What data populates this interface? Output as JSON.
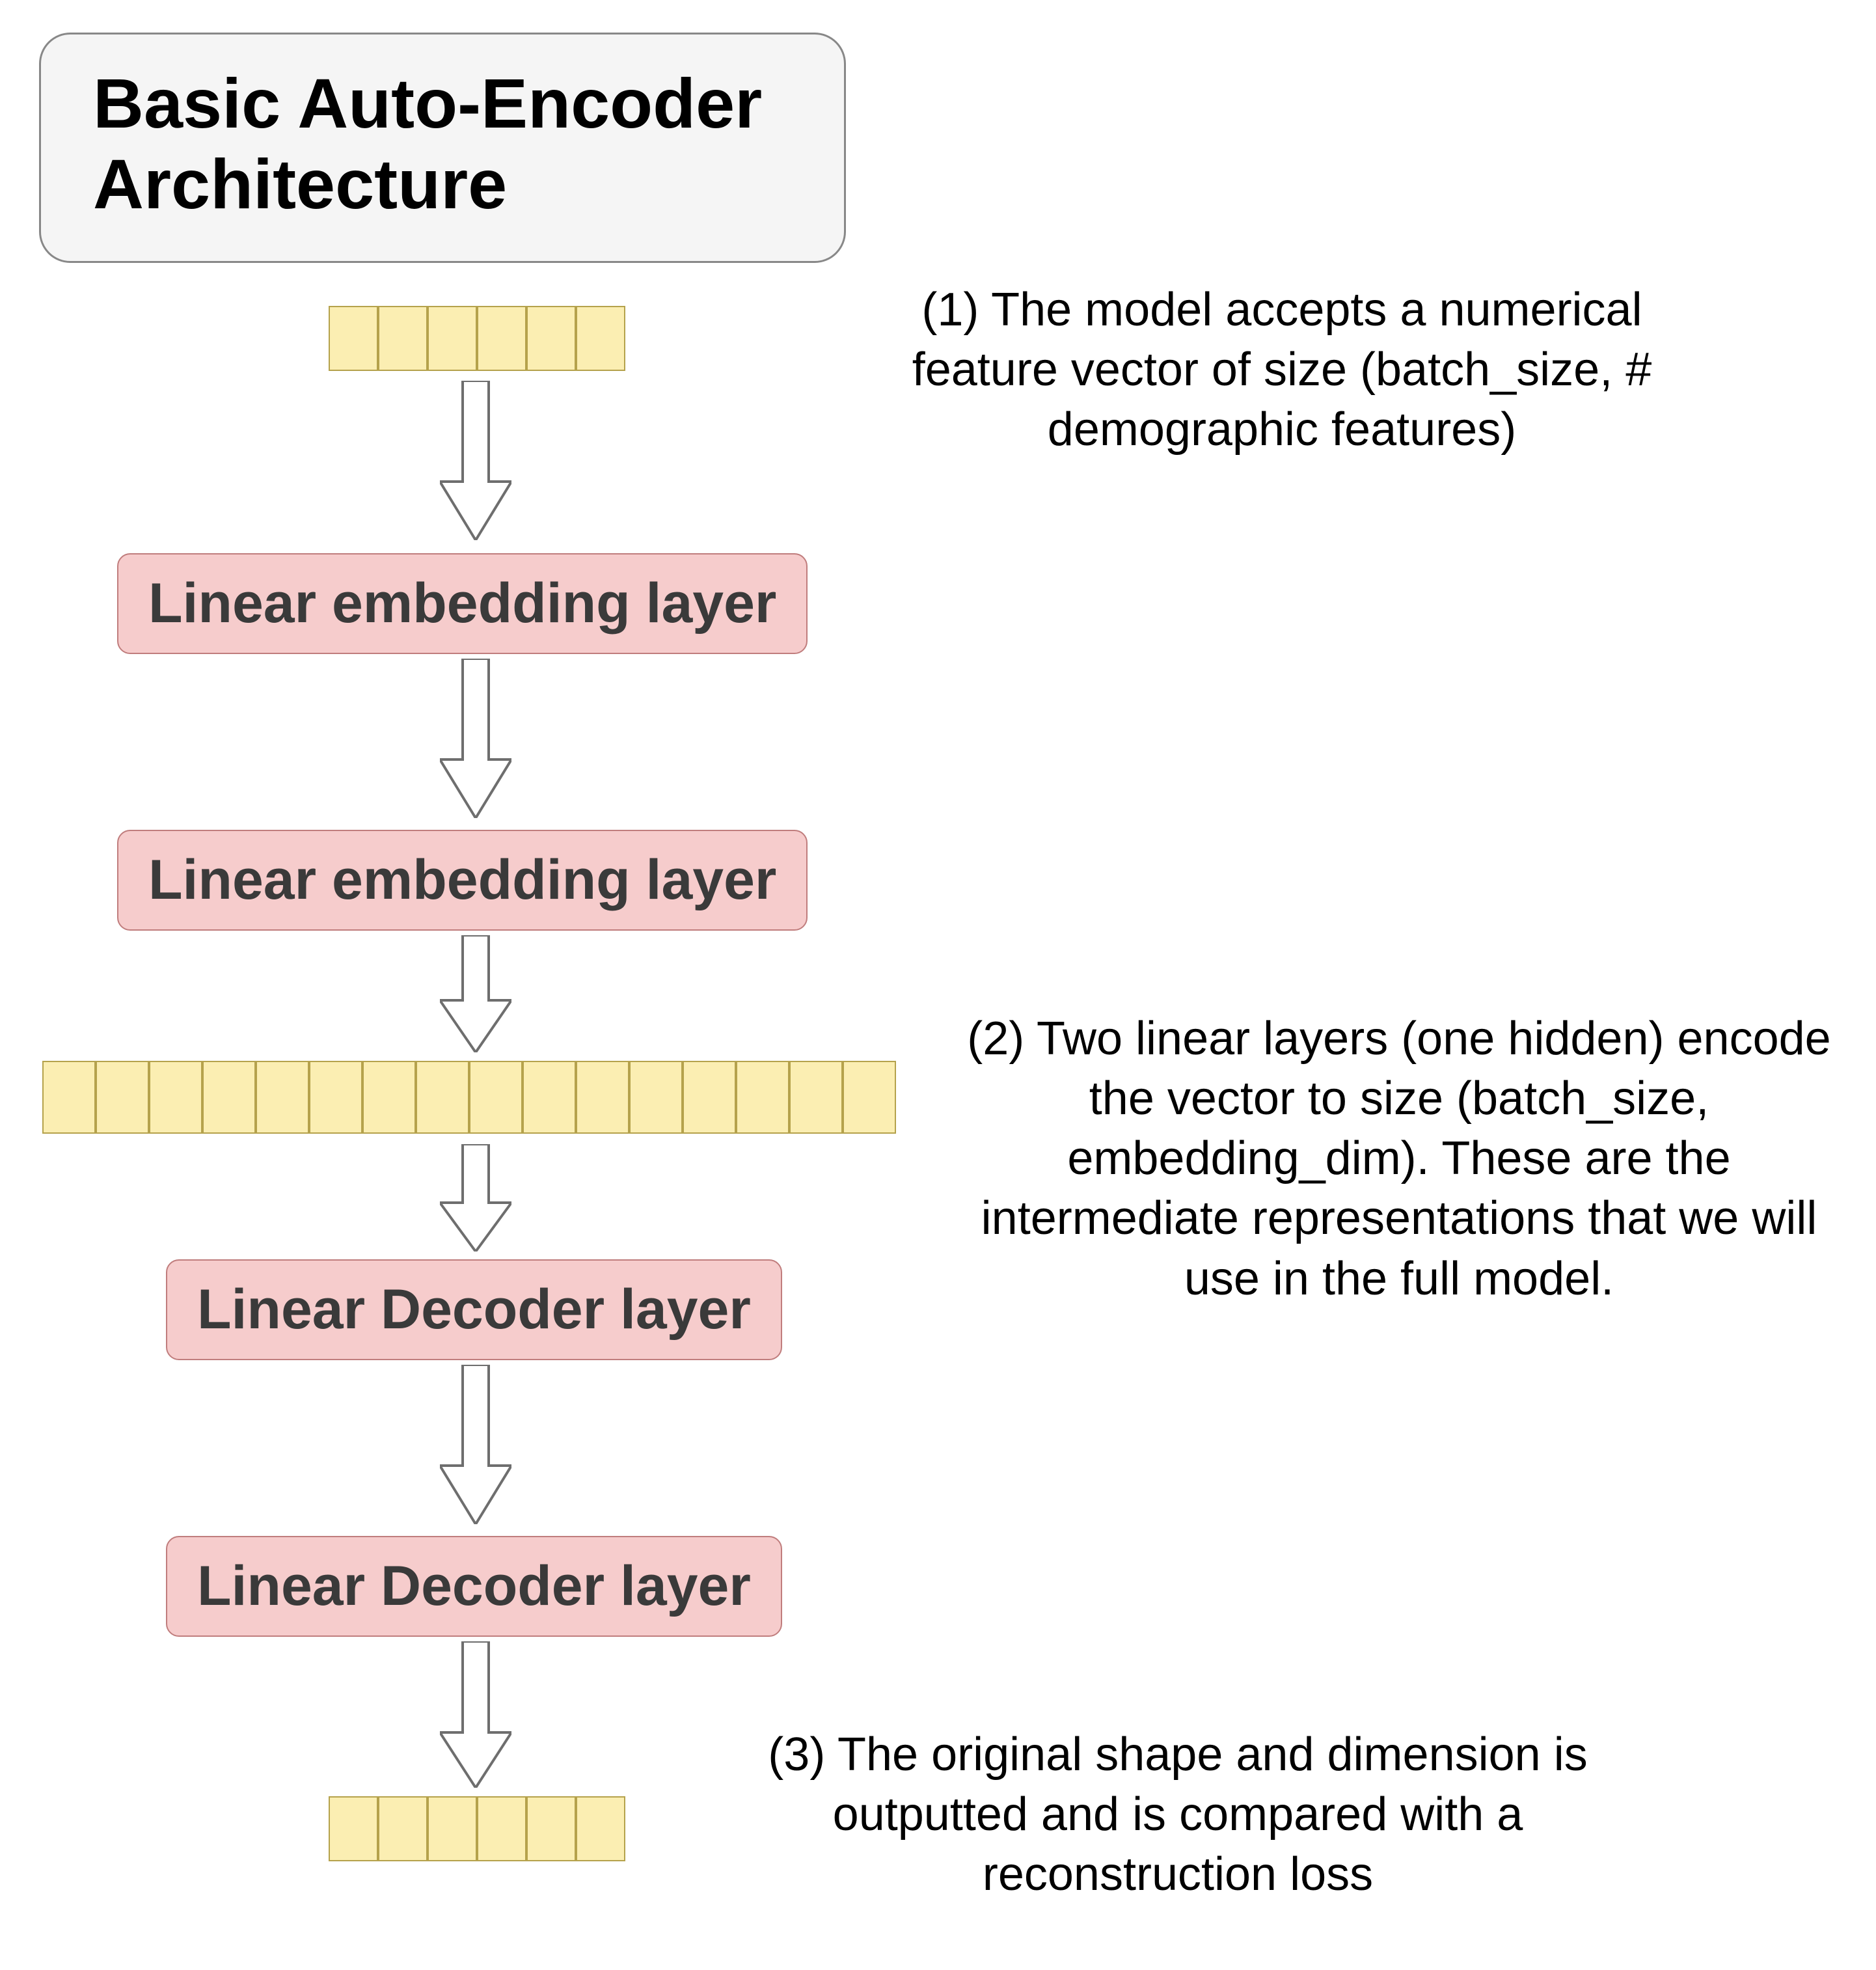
{
  "title": "Basic Auto-Encoder Architecture",
  "layers": {
    "enc1": "Linear embedding layer",
    "enc2": "Linear embedding layer",
    "dec1": "Linear Decoder layer",
    "dec2": "Linear Decoder layer"
  },
  "vectors": {
    "input_cells": 6,
    "embedding_cells": 16,
    "output_cells": 6
  },
  "annotations": {
    "a1": "(1) The model accepts a numerical feature vector of size (batch_size, # demographic features)",
    "a2": "(2) Two linear layers (one hidden) encode the vector to size (batch_size, embedding_dim). These are the intermediate representations that we will use in the full model.",
    "a3": "(3)  The original shape  and dimension is outputted and is compared with a reconstruction loss"
  },
  "arrow_count": 6
}
